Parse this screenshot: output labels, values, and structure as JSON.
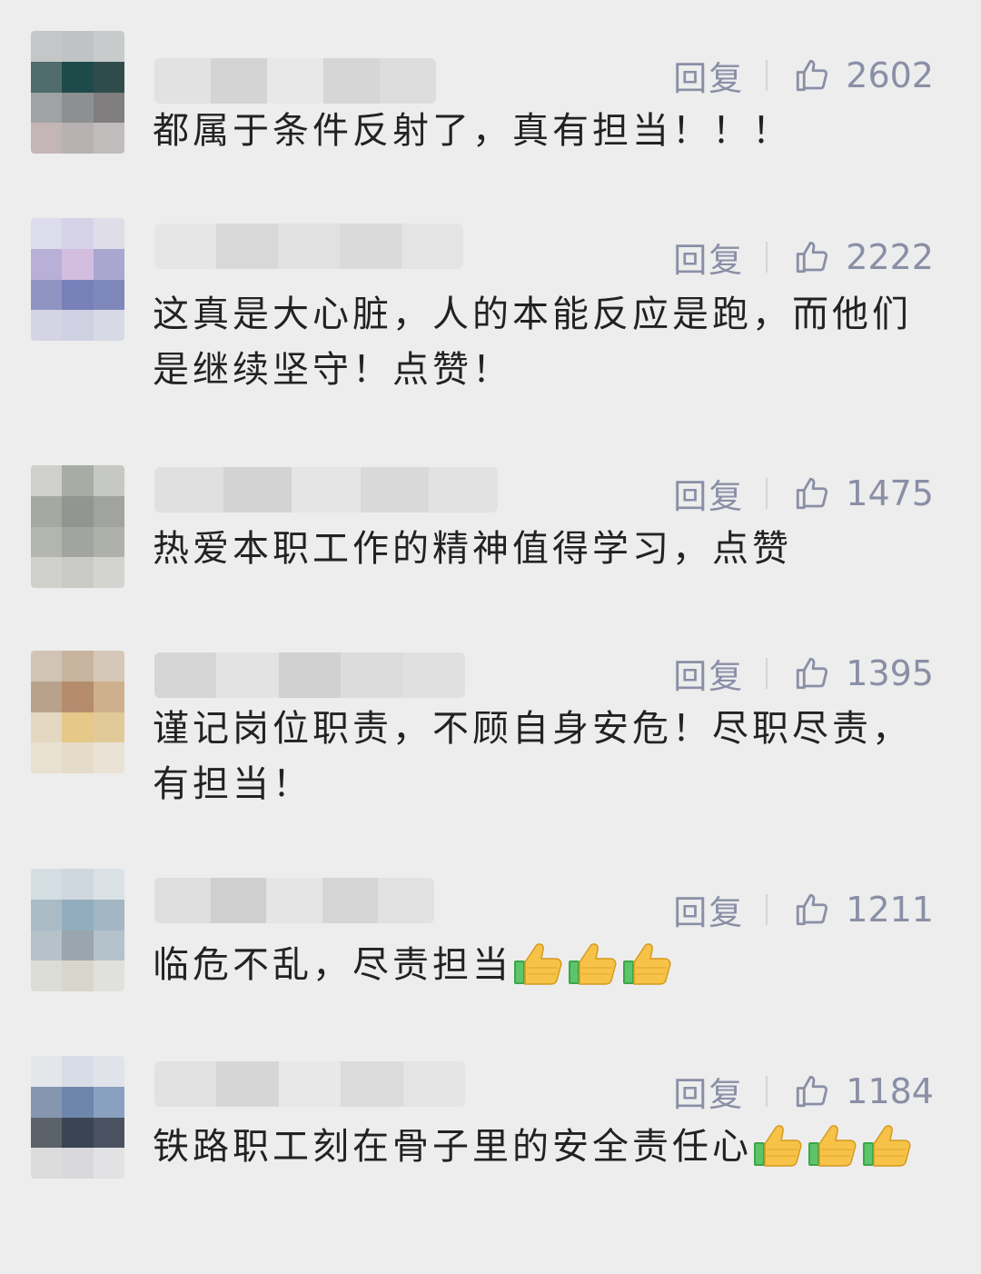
{
  "comments": [
    {
      "reply_label": "回复",
      "like_count": "2602",
      "text": "都属于条件反射了，真有担当！！！",
      "thumbs_emoji": 0,
      "avatar_colors": [
        "#c4c7c7",
        "#bfc3c3",
        "#c8cbcb",
        "#4f6b6c",
        "#1f4a4a",
        "#2f4c4d",
        "#9fa3a3",
        "#8d9090",
        "#7f7d7d",
        "#c4b5b6",
        "#b7b1b2",
        "#c0bcbc"
      ],
      "name_colors": [
        "#e2e2e2",
        "#d4d4d4",
        "#e8e8e8",
        "#d6d6d6",
        "#dddddd"
      ]
    },
    {
      "reply_label": "回复",
      "like_count": "2222",
      "text": "这真是大心脏，人的本能反应是跑，而他们是继续坚守！点赞！",
      "thumbs_emoji": 0,
      "avatar_colors": [
        "#dcdcec",
        "#d5d2e8",
        "#dedde8",
        "#b8b0d6",
        "#d3bee0",
        "#a9a7cf",
        "#8f95c2",
        "#7880b9",
        "#7f88ba",
        "#d4d4e4",
        "#cfd1e3",
        "#d8d9e6"
      ],
      "name_colors": [
        "#e6e6e6",
        "#d8d8d8",
        "#e1e1e1",
        "#dadada",
        "#e4e4e4"
      ]
    },
    {
      "reply_label": "回复",
      "like_count": "1475",
      "text": "热爱本职工作的精神值得学习，点赞",
      "thumbs_emoji": 0,
      "avatar_colors": [
        "#cfd0cd",
        "#a9aba5",
        "#c6c8c3",
        "#a6a8a2",
        "#929590",
        "#a0a39e",
        "#b3b5af",
        "#a2a49f",
        "#aeb0aa",
        "#d0d1cd",
        "#c9cac6",
        "#d3d4d0"
      ],
      "name_colors": [
        "#e0e0e0",
        "#d3d3d3",
        "#e5e5e5",
        "#d9d9d9",
        "#e2e2e2"
      ]
    },
    {
      "reply_label": "回复",
      "like_count": "1395",
      "text": "谨记岗位职责，不顾自身安危！尽职尽责，有担当！",
      "thumbs_emoji": 0,
      "avatar_colors": [
        "#d2c4b4",
        "#c8b49e",
        "#d6c8b8",
        "#b9a28c",
        "#b58d6e",
        "#cfb08c",
        "#e4d8c2",
        "#e6c888",
        "#e2ca98",
        "#e8e0d0",
        "#e4dcc8",
        "#eae2d4"
      ],
      "name_colors": [
        "#d5d5d5",
        "#e3e3e3",
        "#d1d1d1",
        "#dcdcdc",
        "#e0e0e0"
      ]
    },
    {
      "reply_label": "回复",
      "like_count": "1211",
      "text": "临危不乱，尽责担当",
      "thumbs_emoji": 3,
      "avatar_colors": [
        "#d4dde2",
        "#cfd8de",
        "#dbe2e6",
        "#aabbc6",
        "#92aebe",
        "#a2b6c4",
        "#b6c2ca",
        "#9aa6ae",
        "#b4c2cc",
        "#dcdcd6",
        "#d8d6cc",
        "#e0e0dc"
      ],
      "name_colors": [
        "#dedede",
        "#cfcfcf",
        "#e5e5e5",
        "#d5d5d5",
        "#e1e1e1"
      ]
    },
    {
      "reply_label": "回复",
      "like_count": "1184",
      "text": "铁路职工刻在骨子里的安全责任心",
      "thumbs_emoji": 3,
      "avatar_colors": [
        "#e4e6ea",
        "#d6dde6",
        "#e0e4ea",
        "#8696b0",
        "#6f86ac",
        "#8aa0c0",
        "#5c626a",
        "#3a4452",
        "#4a5262",
        "#dcdcdc",
        "#d8d8da",
        "#e2e2e4"
      ],
      "name_colors": [
        "#e2e2e2",
        "#d6d6d6",
        "#e8e8e8",
        "#dbdbdb",
        "#e4e4e4"
      ]
    }
  ],
  "colors": {
    "background": "#ededed",
    "action_text": "#8a8fa6",
    "comment_text": "#222222"
  },
  "icons": {
    "like": "thumbs-up-outline-icon",
    "emoji": "thumbs-up-emoji-icon"
  }
}
